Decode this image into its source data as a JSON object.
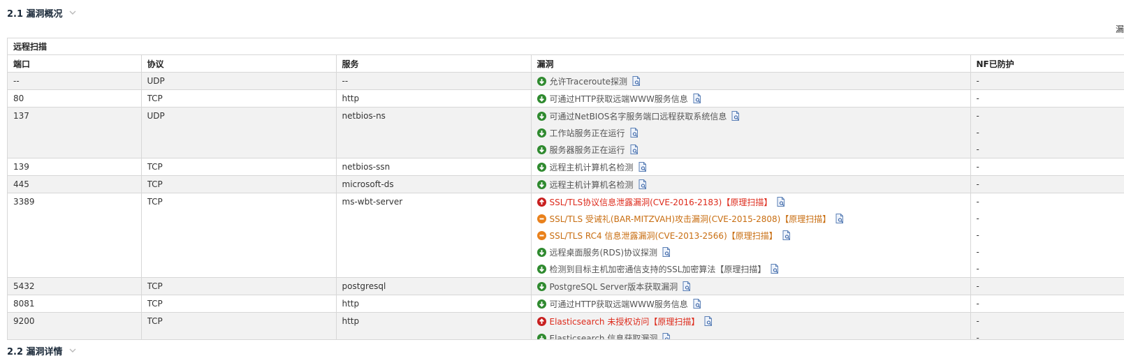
{
  "section1": {
    "title": "2.1 漏洞概况"
  },
  "section2": {
    "title": "2.2 漏洞详情"
  },
  "legend_edge_text": "漏",
  "scan_title": "远程扫描",
  "columns": [
    "端口",
    "协议",
    "服务",
    "漏洞",
    "NF已防护"
  ],
  "severity_colors": {
    "low": "#2f8a2f",
    "medium": "#e9811c",
    "high": "#c82020"
  },
  "rows": [
    {
      "port": "--",
      "protocol": "UDP",
      "service": "--",
      "vulns": [
        {
          "text": "允许Traceroute探测",
          "severity": "low",
          "protected": "-"
        }
      ]
    },
    {
      "port": "80",
      "protocol": "TCP",
      "service": "http",
      "vulns": [
        {
          "text": "可通过HTTP获取远端WWW服务信息",
          "severity": "low",
          "protected": "-"
        }
      ]
    },
    {
      "port": "137",
      "protocol": "UDP",
      "service": "netbios-ns",
      "vulns": [
        {
          "text": "可通过NetBIOS名字服务端口远程获取系统信息",
          "severity": "low",
          "protected": "-"
        },
        {
          "text": "工作站服务正在运行",
          "severity": "low",
          "protected": "-"
        },
        {
          "text": "服务器服务正在运行",
          "severity": "low",
          "protected": "-"
        }
      ]
    },
    {
      "port": "139",
      "protocol": "TCP",
      "service": "netbios-ssn",
      "vulns": [
        {
          "text": "远程主机计算机名检测",
          "severity": "low",
          "protected": "-"
        }
      ]
    },
    {
      "port": "445",
      "protocol": "TCP",
      "service": "microsoft-ds",
      "vulns": [
        {
          "text": "远程主机计算机名检测",
          "severity": "low",
          "protected": "-"
        }
      ]
    },
    {
      "port": "3389",
      "protocol": "TCP",
      "service": "ms-wbt-server",
      "vulns": [
        {
          "text": "SSL/TLS协议信息泄露漏洞(CVE-2016-2183)【原理扫描】",
          "severity": "high",
          "protected": "-"
        },
        {
          "text": "SSL/TLS 受诫礼(BAR-MITZVAH)攻击漏洞(CVE-2015-2808)【原理扫描】",
          "severity": "medium",
          "protected": "-"
        },
        {
          "text": "SSL/TLS RC4 信息泄露漏洞(CVE-2013-2566)【原理扫描】",
          "severity": "medium",
          "protected": "-"
        },
        {
          "text": "远程桌面服务(RDS)协议探测",
          "severity": "low",
          "protected": "-"
        },
        {
          "text": "检测到目标主机加密通信支持的SSL加密算法【原理扫描】",
          "severity": "low",
          "protected": "-"
        }
      ]
    },
    {
      "port": "5432",
      "protocol": "TCP",
      "service": "postgresql",
      "vulns": [
        {
          "text": "PostgreSQL Server版本获取漏洞",
          "severity": "low",
          "protected": "-"
        }
      ]
    },
    {
      "port": "8081",
      "protocol": "TCP",
      "service": "http",
      "vulns": [
        {
          "text": "可通过HTTP获取远端WWW服务信息",
          "severity": "low",
          "protected": "-"
        }
      ]
    },
    {
      "port": "9200",
      "protocol": "TCP",
      "service": "http",
      "vulns": [
        {
          "text": "Elasticsearch 未授权访问【原理扫描】",
          "severity": "high",
          "protected": "-"
        },
        {
          "text": "Elasticsearch 信息获取漏洞",
          "severity": "low",
          "protected": "-"
        }
      ]
    }
  ]
}
